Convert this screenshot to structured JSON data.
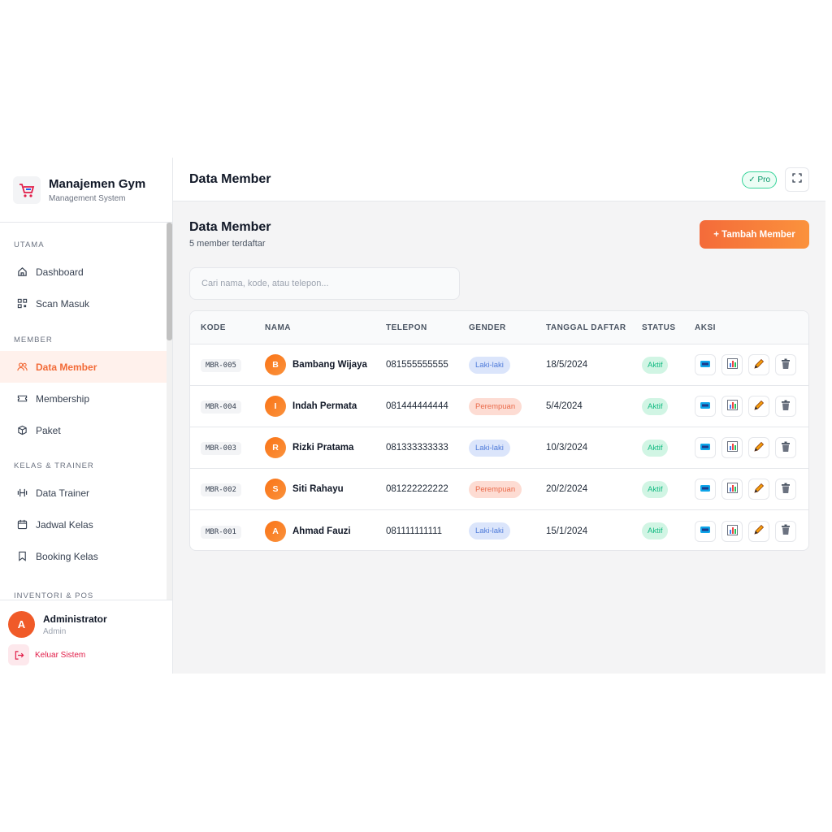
{
  "brand": {
    "title": "Manajemen Gym",
    "subtitle": "Management System"
  },
  "sidebar": {
    "sections": [
      {
        "label": "UTAMA",
        "items": [
          {
            "label": "Dashboard",
            "icon": "home-icon"
          },
          {
            "label": "Scan Masuk",
            "icon": "qr-scan-icon"
          }
        ]
      },
      {
        "label": "MEMBER",
        "items": [
          {
            "label": "Data Member",
            "icon": "users-icon",
            "active": true
          },
          {
            "label": "Membership",
            "icon": "ticket-icon"
          },
          {
            "label": "Paket",
            "icon": "package-icon"
          }
        ]
      },
      {
        "label": "KELAS & TRAINER",
        "items": [
          {
            "label": "Data Trainer",
            "icon": "dumbbell-icon"
          },
          {
            "label": "Jadwal Kelas",
            "icon": "calendar-icon"
          },
          {
            "label": "Booking Kelas",
            "icon": "bookmark-icon"
          }
        ]
      },
      {
        "label": "INVENTORI & POS",
        "items": []
      }
    ]
  },
  "user": {
    "initial": "A",
    "name": "Administrator",
    "role": "Admin"
  },
  "logout_label": "Keluar Sistem",
  "topbar": {
    "title": "Data Member",
    "badge": "✓ Pro"
  },
  "page": {
    "title": "Data Member",
    "subtitle": "5 member terdaftar",
    "add_button": "+ Tambah Member"
  },
  "search": {
    "placeholder": "Cari nama, kode, atau telepon...",
    "value": ""
  },
  "table": {
    "headers": [
      "KODE",
      "NAMA",
      "TELEPON",
      "GENDER",
      "TANGGAL DAFTAR",
      "STATUS",
      "AKSI"
    ],
    "rows": [
      {
        "kode": "MBR-005",
        "initial": "B",
        "nama": "Bambang Wijaya",
        "telepon": "081555555555",
        "gender": "Laki-laki",
        "tanggal": "18/5/2024",
        "status": "Aktif"
      },
      {
        "kode": "MBR-004",
        "initial": "I",
        "nama": "Indah Permata",
        "telepon": "081444444444",
        "gender": "Perempuan",
        "tanggal": "5/4/2024",
        "status": "Aktif"
      },
      {
        "kode": "MBR-003",
        "initial": "R",
        "nama": "Rizki Pratama",
        "telepon": "081333333333",
        "gender": "Laki-laki",
        "tanggal": "10/3/2024",
        "status": "Aktif"
      },
      {
        "kode": "MBR-002",
        "initial": "S",
        "nama": "Siti Rahayu",
        "telepon": "081222222222",
        "gender": "Perempuan",
        "tanggal": "20/2/2024",
        "status": "Aktif"
      },
      {
        "kode": "MBR-001",
        "initial": "A",
        "nama": "Ahmad Fauzi",
        "telepon": "081111111111",
        "gender": "Laki-laki",
        "tanggal": "15/1/2024",
        "status": "Aktif"
      }
    ],
    "actions": [
      "card-icon",
      "chart-icon",
      "pencil-icon",
      "trash-icon"
    ]
  },
  "colors": {
    "accent": "#f26b38",
    "success": "#10b981",
    "male": "#4f7bd9",
    "female": "#ea6a4a",
    "danger": "#e11d48"
  }
}
